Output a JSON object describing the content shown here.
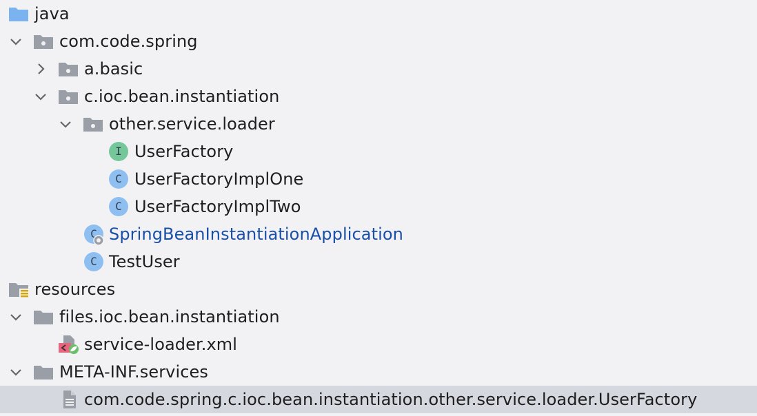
{
  "colors": {
    "background": "#f2f2f5",
    "selection": "#d5d8de",
    "folder_blue": "#7ab3ef",
    "folder_gray": "#9a9ea6",
    "class_badge": "#8fbff0",
    "interface_badge": "#75c79a",
    "link_text": "#1a4fa8"
  },
  "tree": {
    "java": {
      "label": "java",
      "icon": "source-folder-icon"
    },
    "com_code_spring": {
      "label": "com.code.spring",
      "icon": "package-icon",
      "expanded": true
    },
    "a_basic": {
      "label": "a.basic",
      "icon": "package-icon",
      "expanded": false
    },
    "c_ioc": {
      "label": "c.ioc.bean.instantiation",
      "icon": "package-icon",
      "expanded": true
    },
    "other_service_loader": {
      "label": "other.service.loader",
      "icon": "package-icon",
      "expanded": true
    },
    "user_factory": {
      "label": "UserFactory",
      "icon": "interface-icon",
      "badge": "I"
    },
    "user_factory_impl_one": {
      "label": "UserFactoryImplOne",
      "icon": "class-icon",
      "badge": "C"
    },
    "user_factory_impl_two": {
      "label": "UserFactoryImplTwo",
      "icon": "class-icon",
      "badge": "C"
    },
    "spring_app": {
      "label": "SpringBeanInstantiationApplication",
      "icon": "spring-boot-class-icon",
      "badge": "C"
    },
    "test_user": {
      "label": "TestUser",
      "icon": "class-icon",
      "badge": "C"
    },
    "resources": {
      "label": "resources",
      "icon": "resources-folder-icon"
    },
    "files_ioc": {
      "label": "files.ioc.bean.instantiation",
      "icon": "folder-icon",
      "expanded": true
    },
    "service_loader_xml": {
      "label": "service-loader.xml",
      "icon": "spring-xml-icon"
    },
    "meta_inf": {
      "label": "META-INF.services",
      "icon": "folder-icon",
      "expanded": true
    },
    "service_file": {
      "label": "com.code.spring.c.ioc.bean.instantiation.other.service.loader.UserFactory",
      "icon": "text-file-icon",
      "selected": true
    }
  }
}
